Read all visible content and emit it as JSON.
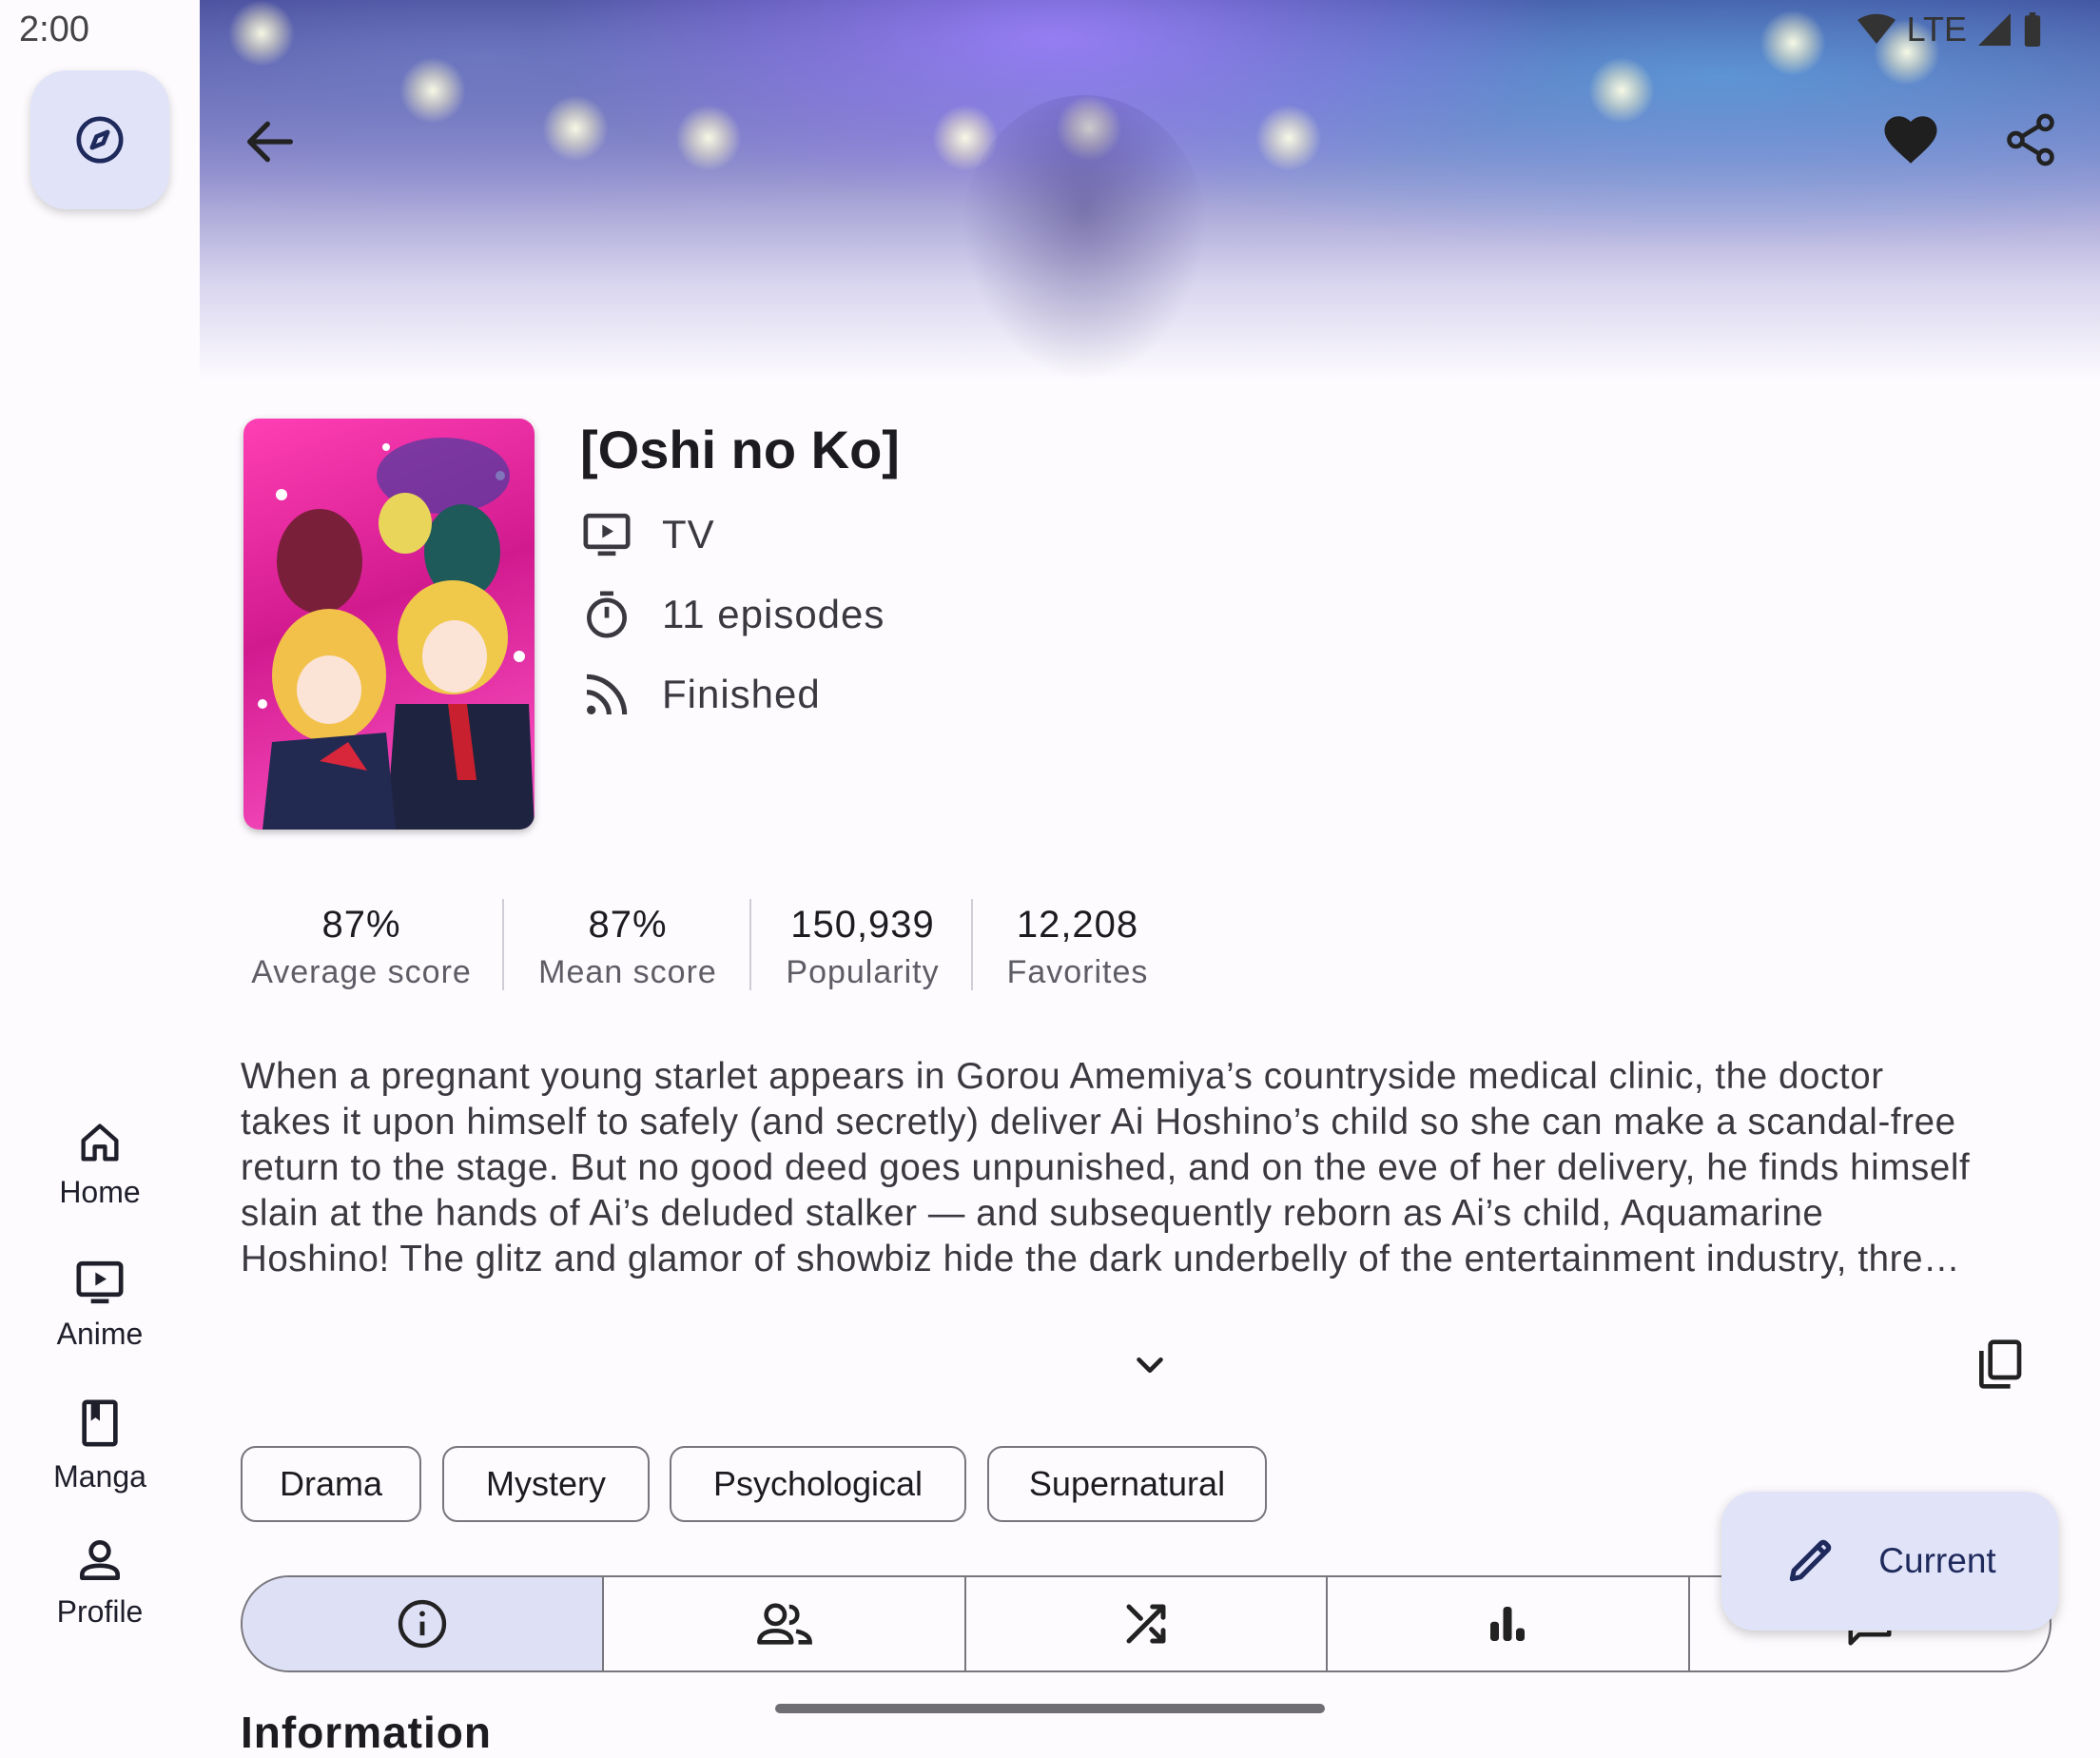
{
  "status_bar": {
    "time": "2:00",
    "network": "LTE"
  },
  "rail": {
    "explore_icon": "compass-icon",
    "items": [
      {
        "label": "Home",
        "icon": "home-icon"
      },
      {
        "label": "Anime",
        "icon": "tv-play-icon"
      },
      {
        "label": "Manga",
        "icon": "book-icon"
      },
      {
        "label": "Profile",
        "icon": "person-icon"
      }
    ]
  },
  "top_bar": {
    "back_icon": "arrow-back-icon",
    "favorite_icon": "heart-icon",
    "share_icon": "share-icon"
  },
  "media": {
    "title": "[Oshi no Ko]",
    "format": "TV",
    "episodes": "11 episodes",
    "status": "Finished"
  },
  "stats": [
    {
      "value": "87%",
      "label": "Average score"
    },
    {
      "value": "87%",
      "label": "Mean score"
    },
    {
      "value": "150,939",
      "label": "Popularity"
    },
    {
      "value": "12,208",
      "label": "Favorites"
    }
  ],
  "description": {
    "lines": [
      "When a pregnant young starlet appears in Gorou Amemiya’s countryside medical clinic, the doctor",
      "takes it upon himself to safely (and secretly) deliver Ai Hoshino’s child so she can make a scandal-free",
      "return to the stage. But no good deed goes unpunished, and on the eve of her delivery, he finds himself",
      "slain at the hands of Ai’s deluded stalker — and subsequently reborn as Ai’s child, Aquamarine",
      "Hoshino! The glitz and glamor of showbiz hide the dark underbelly of the entertainment industry, thre…"
    ],
    "expand_icon": "chevron-down-icon",
    "copy_icon": "copy-icon"
  },
  "genres": [
    "Drama",
    "Mystery",
    "Psychological",
    "Supernatural"
  ],
  "tabs": [
    "info-icon",
    "people-icon",
    "shuffle-icon",
    "bar-chart-icon",
    "comment-icon"
  ],
  "fab": {
    "label": "Current",
    "icon": "pencil-icon"
  },
  "section_title": "Information",
  "colors": {
    "accent_container": "#e1e3f8",
    "outline": "#77767d",
    "background": "#fdfbfe"
  }
}
